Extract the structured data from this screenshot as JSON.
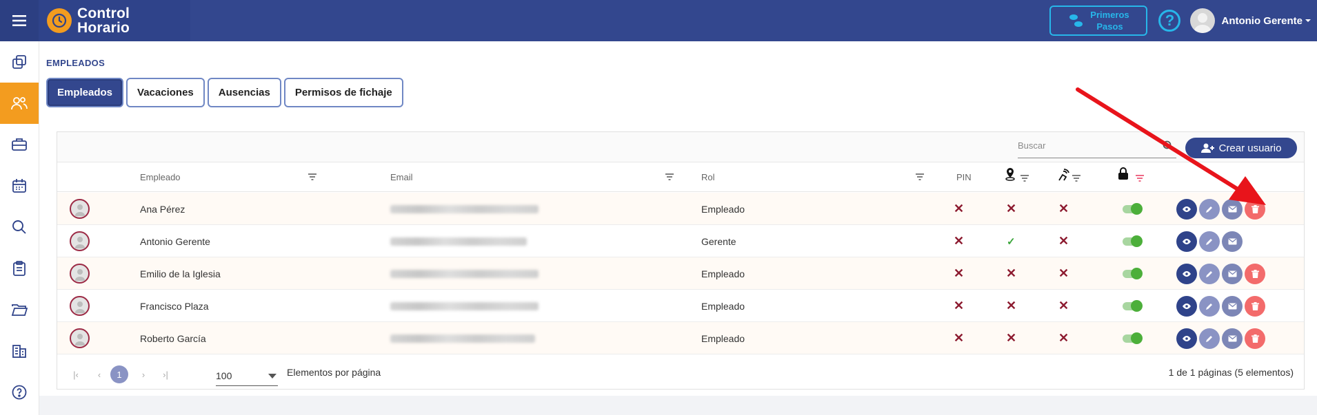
{
  "app": {
    "name_line1": "Control",
    "name_line2": "Horario"
  },
  "header": {
    "first_steps_line1": "Primeros",
    "first_steps_line2": "Pasos",
    "help": "?",
    "user_name": "Antonio Gerente"
  },
  "sidebar": {
    "items": [
      {
        "icon": "copy-icon"
      },
      {
        "icon": "users-icon",
        "active": true
      },
      {
        "icon": "briefcase-icon"
      },
      {
        "icon": "calendar-icon"
      },
      {
        "icon": "search-icon"
      },
      {
        "icon": "clipboard-icon"
      },
      {
        "icon": "folder-icon"
      },
      {
        "icon": "building-icon"
      },
      {
        "icon": "help-circle-icon"
      }
    ]
  },
  "page": {
    "title": "EMPLEADOS"
  },
  "tabs": [
    "Empleados",
    "Vacaciones",
    "Ausencias",
    "Permisos de fichaje"
  ],
  "toolbar": {
    "search_placeholder": "Buscar",
    "create_label": "Crear usuario"
  },
  "table": {
    "columns": {
      "employee": "Empleado",
      "email": "Email",
      "role": "Rol",
      "pin": "PIN"
    },
    "rows": [
      {
        "name": "Ana Pérez",
        "role": "Empleado",
        "pin": "x",
        "location": "x",
        "nfc": "x",
        "active": true,
        "deletable": true
      },
      {
        "name": "Antonio Gerente",
        "role": "Gerente",
        "pin": "x",
        "location": "check",
        "nfc": "x",
        "active": true,
        "deletable": false
      },
      {
        "name": "Emilio de la Iglesia",
        "role": "Empleado",
        "pin": "x",
        "location": "x",
        "nfc": "x",
        "active": true,
        "deletable": true
      },
      {
        "name": "Francisco Plaza",
        "role": "Empleado",
        "pin": "x",
        "location": "x",
        "nfc": "x",
        "active": true,
        "deletable": true
      },
      {
        "name": "Roberto García",
        "role": "Empleado",
        "pin": "x",
        "location": "x",
        "nfc": "x",
        "active": true,
        "deletable": true
      }
    ]
  },
  "footer": {
    "current_page": "1",
    "page_size": "100",
    "per_page_label": "Elementos por página",
    "summary": "1 de 1 páginas (5 elementos)"
  },
  "colors": {
    "primary": "#33478e",
    "accent": "#f39c1f",
    "info": "#27b7ea",
    "danger": "#f36b6b",
    "annotation": "#e8141b"
  }
}
